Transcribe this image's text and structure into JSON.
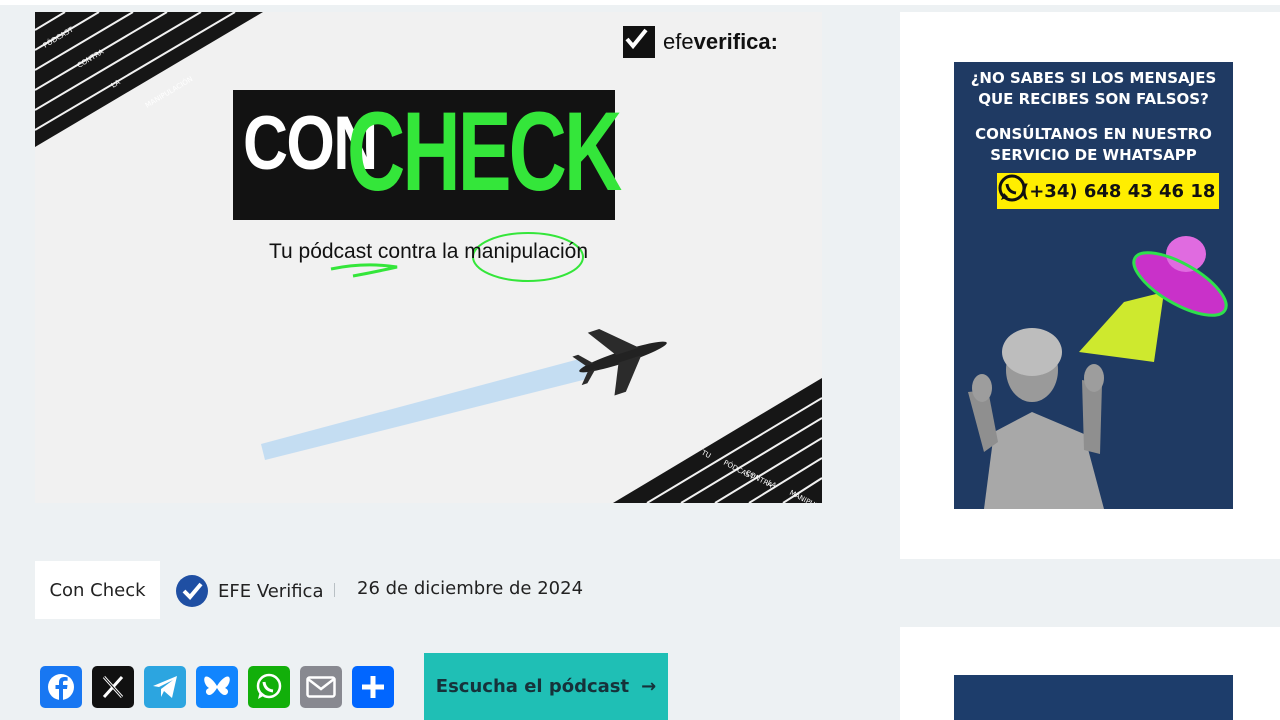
{
  "hero": {
    "brand_prefix": "efe",
    "brand_suffix": "verifica:",
    "title_con": "CON",
    "title_check": "CHECK",
    "tagline_pre": "Tu ",
    "tagline_word1": "pódcast",
    "tagline_mid": " contra la ",
    "tagline_word2": "manipulación",
    "stripe_words": [
      "PÓDCAST",
      "CONTRA",
      "LA",
      "MANIPULACIÓN"
    ],
    "stripe_words_bottom": [
      "TU",
      "PÓDCAST",
      "CONTRA",
      "LA",
      "MANIPULACIÓN"
    ]
  },
  "ad": {
    "line1": "¿NO SABES SI LOS MENSAJES",
    "line2": "QUE RECIBES SON FALSOS?",
    "line3": "CONSÚLTANOS EN NUESTRO",
    "line4": "SERVICIO DE WHATSAPP",
    "phone": "(+34) 648 43 46 18",
    "icon": "whatsapp-icon"
  },
  "meta": {
    "category": "Con Check",
    "author": "EFE Verifica",
    "date": "26 de diciembre de 2024"
  },
  "share": {
    "buttons": [
      {
        "name": "facebook",
        "color": "#1877f2"
      },
      {
        "name": "x",
        "color": "#111111"
      },
      {
        "name": "telegram",
        "color": "#2ca5e0"
      },
      {
        "name": "bluesky",
        "color": "#1185fe"
      },
      {
        "name": "whatsapp",
        "color": "#12af0a"
      },
      {
        "name": "email",
        "color": "#888990"
      },
      {
        "name": "share",
        "color": "#0166ff"
      }
    ]
  },
  "cta": {
    "label": "Escucha el pódcast",
    "arrow": "→"
  },
  "colors": {
    "accent_green": "#34e63a",
    "teal": "#1fbfb5",
    "ad_blue": "#1f3a63",
    "page_bg": "#edf1f3"
  }
}
